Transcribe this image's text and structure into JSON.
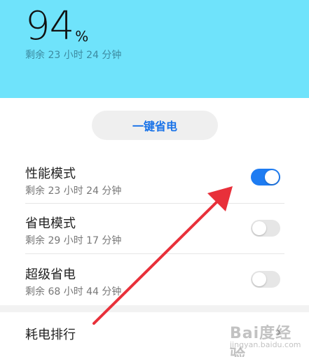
{
  "header": {
    "battery_percent": "94",
    "battery_unit": "%",
    "remaining": "剩余 23 小时 24 分钟"
  },
  "one_tap_button": {
    "label": "一键省电"
  },
  "modes": [
    {
      "title": "性能模式",
      "remaining": "剩余 23 小时 24 分钟",
      "enabled": true
    },
    {
      "title": "省电模式",
      "remaining": "剩余 29 小时 17 分钟",
      "enabled": false
    },
    {
      "title": "超级省电",
      "remaining": "剩余 68 小时 44 分钟",
      "enabled": false
    }
  ],
  "usage_ranking": {
    "label": "耗电排行",
    "chevron": "›"
  },
  "watermark": {
    "logo": "Bai度经验",
    "url": "jingyan.baidu.com"
  },
  "colors": {
    "header_bg": "#6fe3fb",
    "accent": "#1e7cf2",
    "arrow": "#e8303a"
  }
}
